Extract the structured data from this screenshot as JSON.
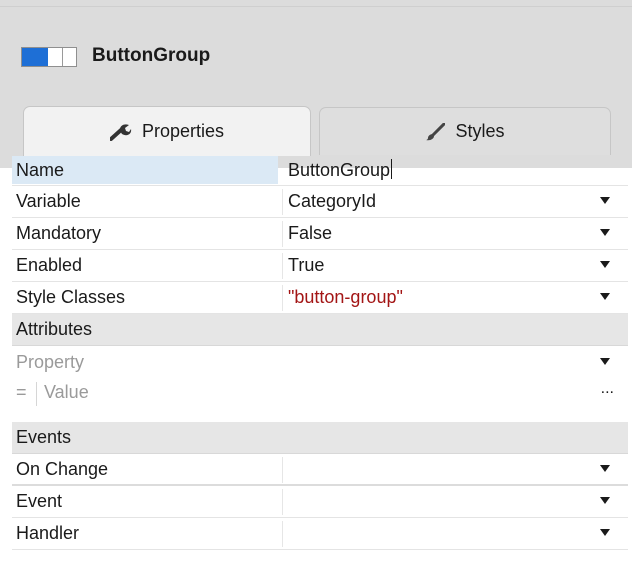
{
  "component": {
    "title": "ButtonGroup",
    "icon": "button-group-icon",
    "icon_color": "#1e6fd6"
  },
  "tabs": [
    {
      "label": "Properties",
      "icon": "wrench-icon",
      "active": true
    },
    {
      "label": "Styles",
      "icon": "brush-icon",
      "active": false
    }
  ],
  "properties": {
    "name": {
      "label": "Name",
      "value": "ButtonGroup"
    },
    "variable": {
      "label": "Variable",
      "value": "CategoryId"
    },
    "mandatory": {
      "label": "Mandatory",
      "value": "False"
    },
    "enabled": {
      "label": "Enabled",
      "value": "True"
    },
    "style_classes": {
      "label": "Style Classes",
      "value": "\"button-group\""
    }
  },
  "attributes": {
    "section_label": "Attributes",
    "property_placeholder": "Property",
    "equals": "=",
    "value_placeholder": "Value",
    "more": "..."
  },
  "events": {
    "section_label": "Events",
    "on_change": {
      "label": "On Change",
      "value": ""
    },
    "event": {
      "label": "Event",
      "value": ""
    },
    "handler": {
      "label": "Handler",
      "value": ""
    }
  }
}
